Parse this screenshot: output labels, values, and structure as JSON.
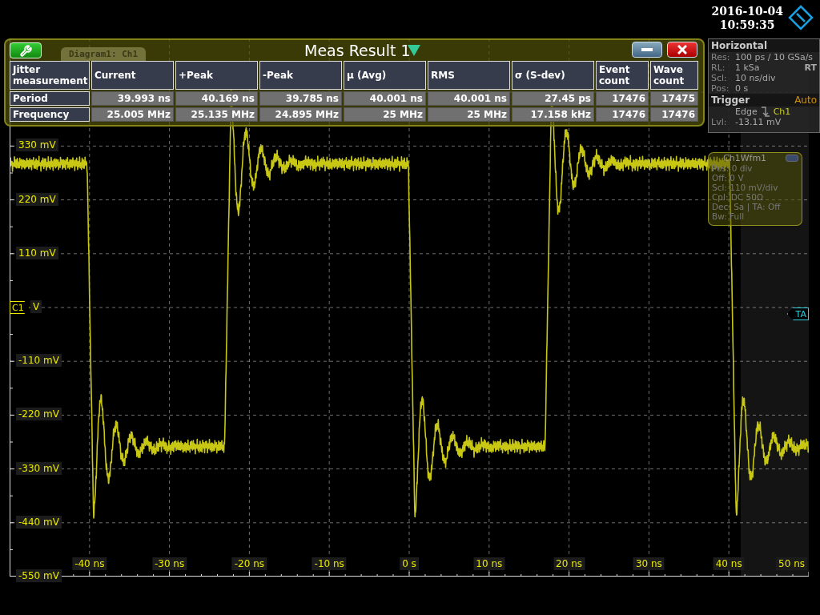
{
  "clock": {
    "date": "2016-10-04",
    "time": "10:59:35"
  },
  "meas_result": {
    "title": "Meas Result 1",
    "tab": "Diagram1: Ch1",
    "columns": [
      "Jitter measurement",
      "Current",
      "+Peak",
      "-Peak",
      "μ (Avg)",
      "RMS",
      "σ (S-dev)",
      "Event count",
      "Wave count"
    ],
    "rows": [
      {
        "cells": [
          "Period",
          "39.993 ns",
          "40.169 ns",
          "39.785 ns",
          "40.001 ns",
          "40.001 ns",
          "27.45 ps",
          "17476",
          "17475"
        ]
      },
      {
        "cells": [
          "Frequency",
          "25.005 MHz",
          "25.135 MHz",
          "24.895 MHz",
          "25 MHz",
          "25 MHz",
          "17.158 kHz",
          "17476",
          "17476"
        ]
      }
    ]
  },
  "horizontal": {
    "title": "Horizontal",
    "rows": [
      {
        "label": "Res:",
        "value": "100 ps / 10 GSa/s"
      },
      {
        "label": "RL:",
        "value": "1 kSa",
        "extra": "RT"
      },
      {
        "label": "Scl:",
        "value": "10 ns/div"
      },
      {
        "label": "Pos:",
        "value": "0 s"
      }
    ]
  },
  "trigger": {
    "title": "Trigger",
    "mode": "Auto",
    "type": "Edge",
    "source": "Ch1",
    "level_label": "Lvl:",
    "level_value": "-13.11 mV"
  },
  "channel_panel": {
    "title": "Ch1Wfm1",
    "lines": [
      "Pos: 0 div",
      "Off: 0 V",
      "Scl: 110 mV/div",
      "Cpl: DC 50Ω",
      "Dec: Sa | TA: Off",
      "Bw: Full"
    ]
  },
  "plot": {
    "y_labels": [
      "330 mV",
      "220 mV",
      "110 mV",
      "V",
      "-110 mV",
      "-220 mV",
      "-330 mV",
      "-440 mV",
      "-550 mV"
    ],
    "x_labels": [
      "-40 ns",
      "-30 ns",
      "-20 ns",
      "-10 ns",
      "0 s",
      "10 ns",
      "20 ns",
      "30 ns",
      "40 ns",
      "50 ns"
    ],
    "channel_marker": "C1",
    "trigger_marker": "TA"
  }
}
